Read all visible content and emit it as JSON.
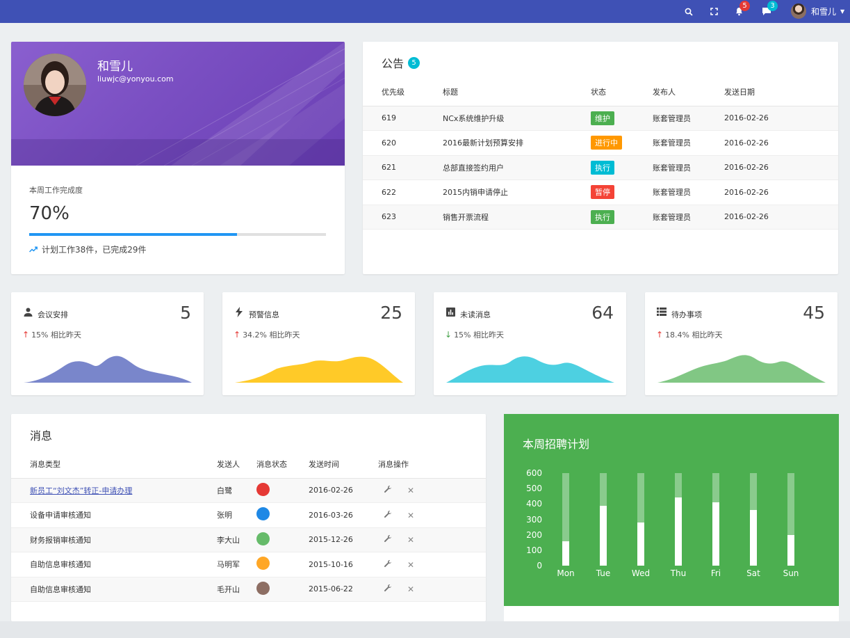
{
  "topbar": {
    "notifications_count": "5",
    "messages_count": "3",
    "username": "和雪儿",
    "colors": {
      "bg": "#3f51b5",
      "notif_badge": "#e53935",
      "msg_badge": "#00bcd4"
    }
  },
  "profile": {
    "name": "和雪儿",
    "email": "liuwjc@yonyou.com",
    "progress_label": "本周工作完成度",
    "progress_value": "70%",
    "progress_fraction": 0.7,
    "progress_note": "计划工作38件，已完成29件"
  },
  "announcements": {
    "title": "公告",
    "badge": "5",
    "columns": [
      "优先级",
      "标题",
      "状态",
      "发布人",
      "发送日期"
    ],
    "rows": [
      {
        "priority": "619",
        "title": "NCx系统维护升级",
        "status": "维护",
        "status_color": "#4caf50",
        "publisher": "账套管理员",
        "date": "2016-02-26"
      },
      {
        "priority": "620",
        "title": "2016最新计划预算安排",
        "status": "进行中",
        "status_color": "#ff9800",
        "publisher": "账套管理员",
        "date": "2016-02-26"
      },
      {
        "priority": "621",
        "title": "总部直接签约用户",
        "status": "执行",
        "status_color": "#00bcd4",
        "publisher": "账套管理员",
        "date": "2016-02-26"
      },
      {
        "priority": "622",
        "title": "2015内销申请停止",
        "status": "暂停",
        "status_color": "#f44336",
        "publisher": "账套管理员",
        "date": "2016-02-26"
      },
      {
        "priority": "623",
        "title": "销售开票流程",
        "status": "执行",
        "status_color": "#4caf50",
        "publisher": "账套管理员",
        "date": "2016-02-26"
      }
    ]
  },
  "stats": [
    {
      "icon": "person-icon",
      "label": "会议安排",
      "value": "5",
      "direction": "up",
      "change": "15% 相比昨天",
      "color": "#7986cb"
    },
    {
      "icon": "flash-icon",
      "label": "预警信息",
      "value": "25",
      "direction": "up",
      "change": "34.2% 相比昨天",
      "color": "#ffca28"
    },
    {
      "icon": "bar-chart-icon",
      "label": "未读消息",
      "value": "64",
      "direction": "down",
      "change": "15% 相比昨天",
      "color": "#4dd0e1"
    },
    {
      "icon": "list-icon",
      "label": "待办事项",
      "value": "45",
      "direction": "up",
      "change": "18.4% 相比昨天",
      "color": "#81c784"
    }
  ],
  "messages": {
    "title": "消息",
    "columns": [
      "消息类型",
      "发送人",
      "消息状态",
      "发送时间",
      "消息操作"
    ],
    "rows": [
      {
        "type": "新员工“刘文杰”转正-申请办理",
        "link": true,
        "sender": "白鹭",
        "status_color": "#e53935",
        "time": "2016-02-26"
      },
      {
        "type": "设备申请审核通知",
        "link": false,
        "sender": "张明",
        "status_color": "#1e88e5",
        "time": "2016-03-26"
      },
      {
        "type": "财务报销审核通知",
        "link": false,
        "sender": "李大山",
        "status_color": "#66bb6a",
        "time": "2015-12-26"
      },
      {
        "type": "自助信息审核通知",
        "link": false,
        "sender": "马明军",
        "status_color": "#ffa726",
        "time": "2015-10-16"
      },
      {
        "type": "自助信息审核通知",
        "link": false,
        "sender": "毛开山",
        "status_color": "#8d6e63",
        "time": "2015-06-22"
      }
    ]
  },
  "recruit": {
    "title": "本周招聘计划",
    "bg_color": "#4caf50",
    "chart_data": {
      "type": "bar",
      "categories": [
        "Mon",
        "Tue",
        "Wed",
        "Thu",
        "Fri",
        "Sat",
        "Sun"
      ],
      "series": [
        {
          "values": [
            600,
            600,
            600,
            600,
            600,
            600,
            600
          ]
        },
        {
          "values": [
            160,
            390,
            280,
            440,
            410,
            360,
            200
          ]
        }
      ],
      "yticks": [
        "600",
        "500",
        "400",
        "300",
        "200",
        "100",
        "0"
      ],
      "ylim": [
        0,
        600
      ]
    }
  }
}
